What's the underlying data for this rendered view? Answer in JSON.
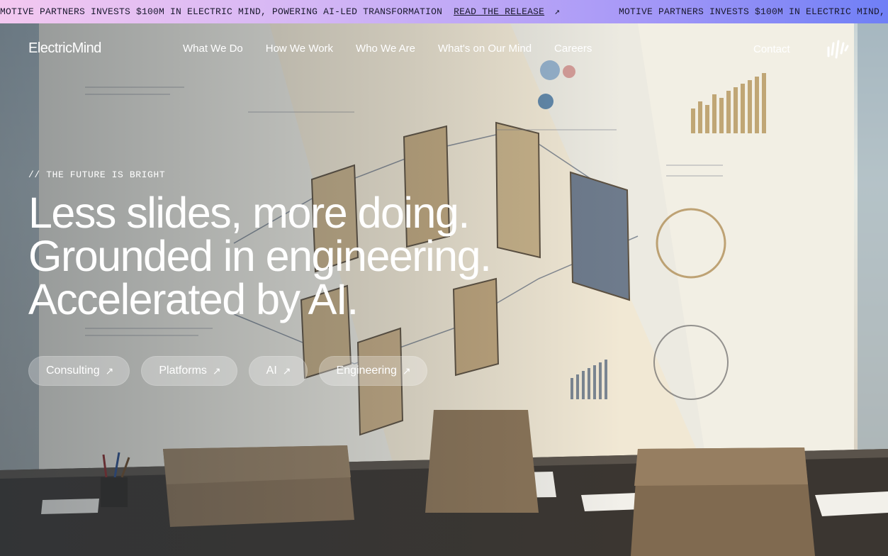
{
  "ticker": {
    "message": "MOTIVE PARTNERS INVESTS $100M IN ELECTRIC MIND, POWERING AI-LED TRANSFORMATION",
    "link_label": "READ THE RELEASE",
    "link_icon": "arrow-up-right-icon",
    "repeat_message": "MOTIVE PARTNERS INVESTS $100M IN ELECTRIC MIND, PO"
  },
  "nav": {
    "logo": "ElectricMind",
    "items": [
      {
        "label": "What We Do"
      },
      {
        "label": "How We Work"
      },
      {
        "label": "Who We Are"
      },
      {
        "label": "What's on Our Mind"
      },
      {
        "label": "Careers"
      }
    ],
    "contact": "Contact",
    "mark_icon": "electric-mind-mark-icon"
  },
  "hero": {
    "eyebrow": "// THE FUTURE IS BRIGHT",
    "headline": [
      "Less slides, more doing.",
      "Grounded in engineering.",
      "Accelerated by AI."
    ],
    "pills": [
      {
        "label": "Consulting",
        "icon": "arrow-up-right-icon"
      },
      {
        "label": "Platforms",
        "icon": "arrow-up-right-icon"
      },
      {
        "label": "AI",
        "icon": "arrow-up-right-icon"
      },
      {
        "label": "Engineering",
        "icon": "arrow-up-right-icon"
      }
    ]
  },
  "colors": {
    "ticker_gradient_start": "#f3c8f0",
    "ticker_gradient_end": "#6f7ff6",
    "text_on_hero": "#ffffff"
  }
}
